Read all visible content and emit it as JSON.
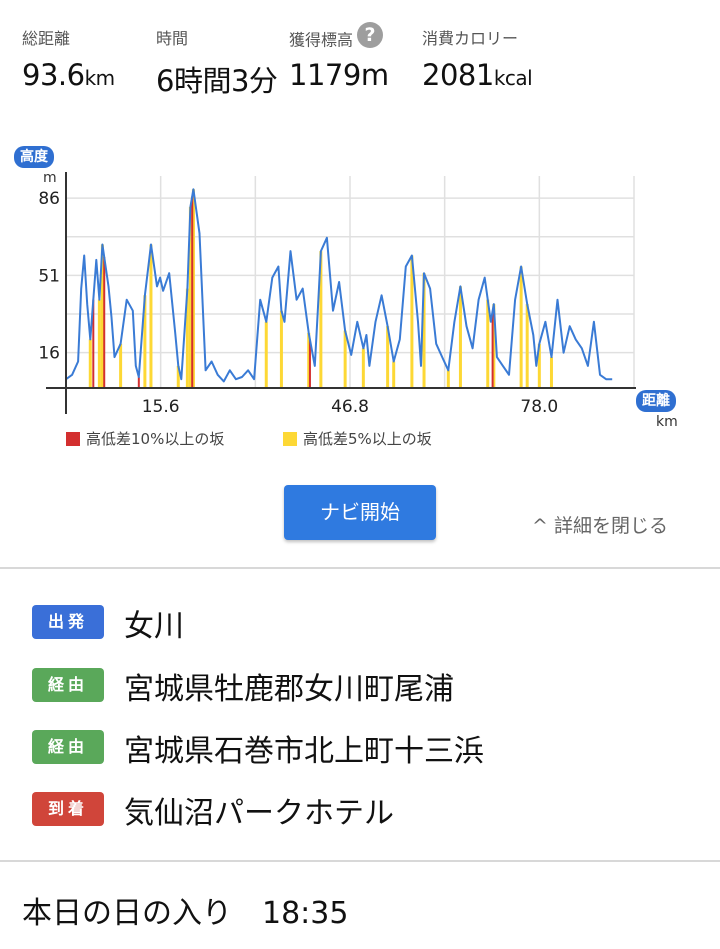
{
  "stats": [
    {
      "label": "総距離",
      "value": "93.6",
      "unit": "km"
    },
    {
      "label": "時間",
      "value": "6時間3分",
      "unit": ""
    },
    {
      "label": "獲得標高",
      "value": "1179",
      "unit": "m"
    },
    {
      "label": "消費カロリー",
      "value": "2081",
      "unit": "kcal"
    }
  ],
  "help_icon": "?",
  "chart_data": {
    "type": "area",
    "ylabel": "高度",
    "y_unit": "m",
    "xlabel": "距離",
    "x_unit": "km",
    "yticks": [
      16,
      51,
      86
    ],
    "xticks": [
      15.6,
      46.8,
      78.0
    ],
    "xlim": [
      0,
      93.6
    ],
    "ylim": [
      0,
      96
    ],
    "line_color": "#3a7bd5",
    "series": [
      {
        "values_x": [
          0,
          1,
          2,
          2.5,
          3,
          3.5,
          4,
          5,
          5.5,
          6,
          7,
          7.5,
          8,
          9,
          10,
          11,
          11.5,
          12,
          13,
          14,
          15,
          15.5,
          16,
          17,
          18,
          18.5,
          19,
          20,
          20.5,
          21,
          22,
          23,
          24,
          25,
          26,
          27,
          28,
          29,
          30,
          31,
          32,
          33,
          34,
          35,
          35.5,
          36,
          37,
          38,
          39,
          40,
          41,
          41.5,
          42,
          43,
          44,
          45,
          46,
          47,
          48,
          49,
          49.5,
          50,
          51,
          52,
          53,
          54,
          55,
          56,
          57,
          58,
          58.5,
          59,
          60,
          61,
          62,
          63,
          64,
          65,
          66,
          67,
          68,
          69,
          70,
          70.5,
          71,
          72,
          73,
          74,
          75,
          76,
          77,
          77.5,
          78,
          79,
          80,
          81,
          82,
          83,
          84,
          85,
          86,
          87,
          88,
          89,
          90,
          91,
          92,
          93.6
        ],
        "values_y": [
          4,
          6,
          12,
          45,
          60,
          38,
          22,
          58,
          40,
          65,
          46,
          32,
          14,
          20,
          40,
          35,
          10,
          5,
          42,
          65,
          46,
          50,
          44,
          52,
          25,
          10,
          4,
          45,
          82,
          90,
          70,
          8,
          12,
          6,
          3,
          8,
          4,
          5,
          8,
          4,
          40,
          30,
          50,
          55,
          35,
          30,
          62,
          40,
          45,
          25,
          10,
          35,
          62,
          68,
          35,
          48,
          26,
          15,
          30,
          18,
          24,
          10,
          30,
          42,
          28,
          12,
          22,
          55,
          60,
          30,
          10,
          52,
          45,
          20,
          14,
          8,
          30,
          46,
          28,
          18,
          40,
          50,
          30,
          38,
          14,
          10,
          6,
          40,
          55,
          38,
          24,
          10,
          20,
          30,
          14,
          40,
          16,
          28,
          22,
          18,
          10,
          30,
          6,
          4,
          4
        ],
        "color": "#3a7bd5"
      }
    ],
    "legend": [
      {
        "label": "高低差10%以上の坂",
        "color": "#d32f2f"
      },
      {
        "label": "高低差5%以上の坂",
        "color": "#fdd835"
      }
    ],
    "slopes_5pct_x": [
      4,
      5.5,
      6,
      9,
      13,
      14,
      18.5,
      20,
      20.5,
      21,
      33,
      35.5,
      40,
      42,
      46,
      49,
      53,
      54,
      57,
      59,
      63,
      65,
      69.5,
      70.5,
      75,
      76,
      78,
      80
    ],
    "slopes_10pct_x": [
      4.5,
      6.3,
      12,
      20.8,
      40.2,
      70.3
    ]
  },
  "buttons": {
    "navi": "ナビ開始",
    "close_details": "^ 詳細を閉じる"
  },
  "route": [
    {
      "badge": "出発",
      "color": "#3a6fd8",
      "place": "女川"
    },
    {
      "badge": "経由",
      "color": "#5aa85a",
      "place": "宮城県牡鹿郡女川町尾浦"
    },
    {
      "badge": "経由",
      "color": "#5aa85a",
      "place": "宮城県石巻市北上町十三浜"
    },
    {
      "badge": "到着",
      "color": "#d0453a",
      "place": "気仙沼パークホテル"
    }
  ],
  "sunset": {
    "label": "本日の日の入り",
    "time": "18:35"
  }
}
